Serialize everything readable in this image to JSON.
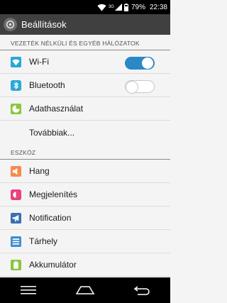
{
  "status": {
    "network": "3G",
    "battery_percent": "79%",
    "time": "22:38"
  },
  "header": {
    "title": "Beállítások",
    "icon": "settings-gear-icon"
  },
  "sections": [
    {
      "header": "VEZETÉK NÉLKÜLI ÉS EGYÉB HÁLÓZATOK",
      "items": [
        {
          "label": "Wi-Fi",
          "icon": "wifi-icon",
          "toggle": true
        },
        {
          "label": "Bluetooth",
          "icon": "bluetooth-icon",
          "toggle": false
        },
        {
          "label": "Adathasználat",
          "icon": "data-usage-icon"
        },
        {
          "label": "Továbbiak...",
          "icon": ""
        }
      ]
    },
    {
      "header": "ESZKÖZ",
      "items": [
        {
          "label": "Hang",
          "icon": "sound-icon"
        },
        {
          "label": "Megjelenítés",
          "icon": "display-icon"
        },
        {
          "label": "Notification",
          "icon": "notification-icon"
        },
        {
          "label": "Tárhely",
          "icon": "storage-icon"
        },
        {
          "label": "Akkumulátor",
          "icon": "battery-icon"
        }
      ]
    }
  ],
  "colors": {
    "wifi": "#29a8d8",
    "bluetooth": "#29a8d8",
    "data_usage": "#8cc63f",
    "sound": "#f58b4c",
    "display": "#e8417f",
    "notification": "#3a6fb5",
    "storage": "#3f8ed0",
    "battery": "#8cc63f",
    "toggle_on": "#2a88c6"
  }
}
